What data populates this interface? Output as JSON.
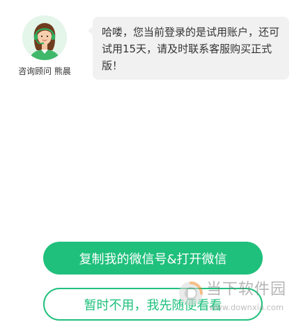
{
  "advisor": {
    "name_label": "咨询顾问 熊晨",
    "avatar_icon": "advisor-avatar-icon"
  },
  "message": {
    "text": "哈喽，您当前登录的是试用账户，还可试用15天，请及时联系客服购买正式版！"
  },
  "actions": {
    "primary_label": "复制我的微信号&打开微信",
    "secondary_label": "暂时不用，我先随便看看"
  },
  "watermark": {
    "brand": "当下软件园",
    "url": "www.downxia.com",
    "logo_icon": "downxia-logo-icon"
  },
  "colors": {
    "accent": "#1fc07c",
    "bubble": "#f1f1f1",
    "text": "#333333",
    "avatar_bg": "#e4f5e9"
  }
}
